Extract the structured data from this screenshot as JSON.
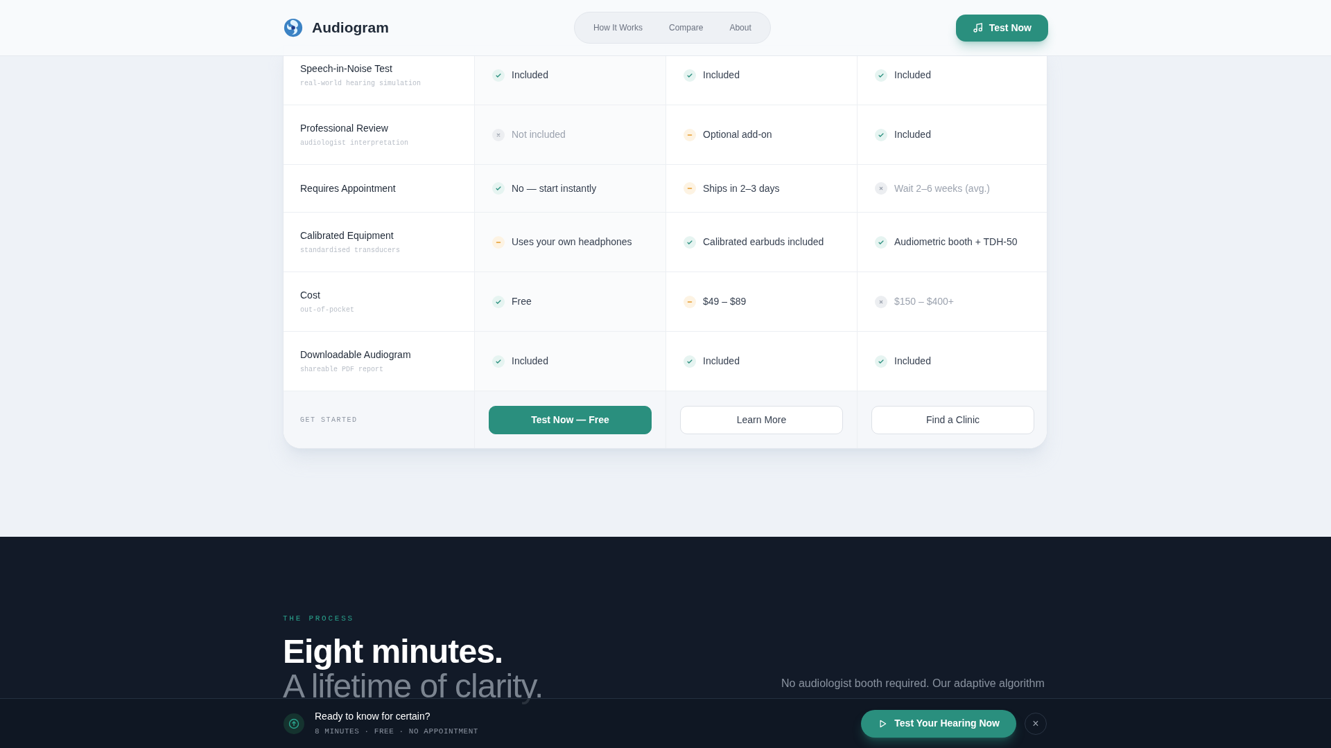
{
  "header": {
    "brand": "Audiogram",
    "nav": [
      {
        "label": "How It Works"
      },
      {
        "label": "Compare"
      },
      {
        "label": "About"
      }
    ],
    "cta": "Test Now"
  },
  "comparison": {
    "rows": [
      {
        "feature": "Speech-in-Noise Test",
        "note": "real-world hearing simulation",
        "cells": [
          {
            "kind": "yes",
            "text": "Included"
          },
          {
            "kind": "yes",
            "text": "Included"
          },
          {
            "kind": "yes",
            "text": "Included"
          }
        ]
      },
      {
        "feature": "Professional Review",
        "note": "audiologist interpretation",
        "cells": [
          {
            "kind": "no",
            "text": "Not included"
          },
          {
            "kind": "partial",
            "text": "Optional add-on"
          },
          {
            "kind": "yes",
            "text": "Included"
          }
        ]
      },
      {
        "feature": "Requires Appointment",
        "cells": [
          {
            "kind": "yes",
            "text": "No — start instantly"
          },
          {
            "kind": "partial",
            "text": "Ships in 2–3 days"
          },
          {
            "kind": "no",
            "text": "Wait 2–6 weeks (avg.)"
          }
        ]
      },
      {
        "feature": "Calibrated Equipment",
        "note": "standardised transducers",
        "cells": [
          {
            "kind": "partial",
            "text": "Uses your own headphones"
          },
          {
            "kind": "yes",
            "text": "Calibrated earbuds included"
          },
          {
            "kind": "yes",
            "text": "Audiometric booth + TDH-50"
          }
        ]
      },
      {
        "feature": "Cost",
        "note": "out-of-pocket",
        "cells": [
          {
            "kind": "yes",
            "text": "Free"
          },
          {
            "kind": "partial",
            "text": "$49 – $89"
          },
          {
            "kind": "no",
            "text": "$150 – $400+"
          }
        ]
      },
      {
        "feature": "Downloadable Audiogram",
        "note": "shareable PDF report",
        "cells": [
          {
            "kind": "yes",
            "text": "Included"
          },
          {
            "kind": "yes",
            "text": "Included"
          },
          {
            "kind": "yes",
            "text": "Included"
          }
        ]
      }
    ],
    "footer_label": "GET STARTED",
    "actions": [
      {
        "label": "Test Now — Free",
        "kind": "primary"
      },
      {
        "label": "Learn More",
        "kind": "outline"
      },
      {
        "label": "Find a Clinic",
        "kind": "outline"
      }
    ]
  },
  "process": {
    "eyebrow": "THE PROCESS",
    "heading": "Eight minutes.",
    "subheading": "A lifetime of clarity.",
    "lead": "No audiologist booth required. Our adaptive algorithm"
  },
  "sticky_bar": {
    "title": "Ready to know for certain?",
    "meta": "8 MINUTES · FREE · NO APPOINTMENT",
    "cta": "Test Your Hearing Now",
    "close": "×"
  }
}
